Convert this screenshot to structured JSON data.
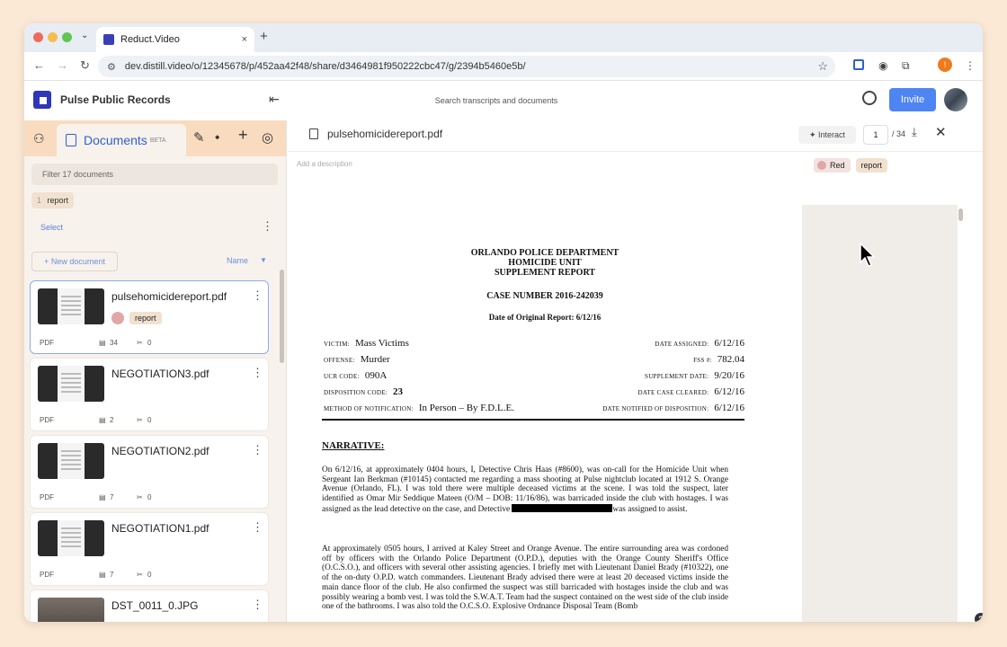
{
  "browser": {
    "tab_title": "Reduct.Video",
    "tab_close": "×",
    "new_tab": "+",
    "tab_dropdown": "⌄",
    "url": "dev.distill.video/o/12345678/p/452aa42f48/share/d3464981f950222cbc47/g/2394b5460e5b/",
    "nav_back": "←",
    "nav_forward": "→",
    "nav_reload": "↻",
    "star": "☆",
    "profile_initial": "!"
  },
  "app": {
    "workspace_name": "Pulse Public Records",
    "search_placeholder": "Search transcripts and documents",
    "invite_label": "Invite",
    "collapse_glyph": "⇤"
  },
  "sidebar": {
    "documents_tab_label": "Documents",
    "documents_tab_badge": "BETA",
    "filter_placeholder": "Filter 17 documents",
    "active_filter": {
      "count": "1",
      "label": "report"
    },
    "select_label": "Select",
    "new_document_label": "+ New document",
    "sort_label": "Name",
    "sort_arrow": "▼",
    "documents": [
      {
        "name": "pulsehomicidereport.pdf",
        "type": "PDF",
        "pages": "34",
        "clips": "0",
        "tag_color": "Red",
        "tag": "report",
        "selected": true
      },
      {
        "name": "NEGOTIATION3.pdf",
        "type": "PDF",
        "pages": "2",
        "clips": "0"
      },
      {
        "name": "NEGOTIATION2.pdf",
        "type": "PDF",
        "pages": "7",
        "clips": "0"
      },
      {
        "name": "NEGOTIATION1.pdf",
        "type": "PDF",
        "pages": "7",
        "clips": "0"
      },
      {
        "name": "DST_0011_0.JPG",
        "type": "",
        "pages": "",
        "clips": ""
      }
    ]
  },
  "viewer": {
    "document_title": "pulsehomicidereport.pdf",
    "interact_label": "Interact",
    "page_current": "1",
    "page_total": "/ 34",
    "description_placeholder": "Add a description",
    "tags": [
      {
        "label": "Red",
        "color": "#e0a7a8"
      },
      {
        "label": "report"
      }
    ],
    "help_label": "?"
  },
  "pdf": {
    "header_line1": "ORLANDO POLICE DEPARTMENT",
    "header_line2": "HOMICIDE UNIT",
    "header_line3": "SUPPLEMENT REPORT",
    "case_number": "CASE NUMBER 2016-242039",
    "original_date": "Date of Original Report:  6/12/16",
    "fields": {
      "victim_label": "VICTIM:",
      "victim": "Mass Victims",
      "offense_label": "OFFENSE:",
      "offense": "Murder",
      "ucr_label": "UCR CODE:",
      "ucr": "090A",
      "disposition_label": "DISPOSITION CODE:",
      "disposition": "23",
      "notification_label": "METHOD OF NOTIFICATION:",
      "notification": "In Person – By F.D.L.E.",
      "date_assigned_label": "DATE ASSIGNED:",
      "date_assigned": "6/12/16",
      "fss_label": "FSS #:",
      "fss": "782.04",
      "supplement_label": "SUPPLEMENT DATE:",
      "supplement": "9/20/16",
      "cleared_label": "DATE CASE CLEARED:",
      "cleared": "6/12/16",
      "notified_label": "DATE NOTIFIED OF DISPOSITION:",
      "notified": "6/12/16"
    },
    "narrative_heading": "NARRATIVE:",
    "para1_a": "On 6/12/16, at approximately 0404 hours, I, Detective Chris Haas (#8600), was on-call for the Homicide Unit when Sergeant Ian Berkman (#10145) contacted me regarding a mass shooting at Pulse nightclub located at 1912 S. Orange Avenue (Orlando, FL).  I was told there were multiple deceased victims at the scene.  I was told the suspect, later identified as Omar Mir Seddique Mateen (O/M – DOB: 11/16/86), was barricaded inside the club with hostages.  I was assigned as the lead detective on the case, and Detective",
    "para1_b": "was assigned to assist.",
    "para2": "At approximately 0505 hours, I arrived at Kaley Street and Orange Avenue.  The entire surrounding area was cordoned off by officers with the Orlando Police Department (O.P.D.), deputies with the Orange County Sheriff's Office (O.C.S.O.), and officers with several other assisting agencies.  I briefly met with Lieutenant Daniel Brady (#10322), one of the on-duty O.P.D. watch commanders.  Lieutenant Brady advised there were at least 20 deceased victims inside the main dance floor of the club.  He also confirmed the suspect was still barricaded with hostages inside the club and was possibly wearing a bomb vest.  I was told the S.W.A.T. Team had the suspect contained on the west side of the club inside one of the bathrooms.  I was also told the O.C.S.O. Explosive Ordnance Disposal Team (Bomb"
  }
}
